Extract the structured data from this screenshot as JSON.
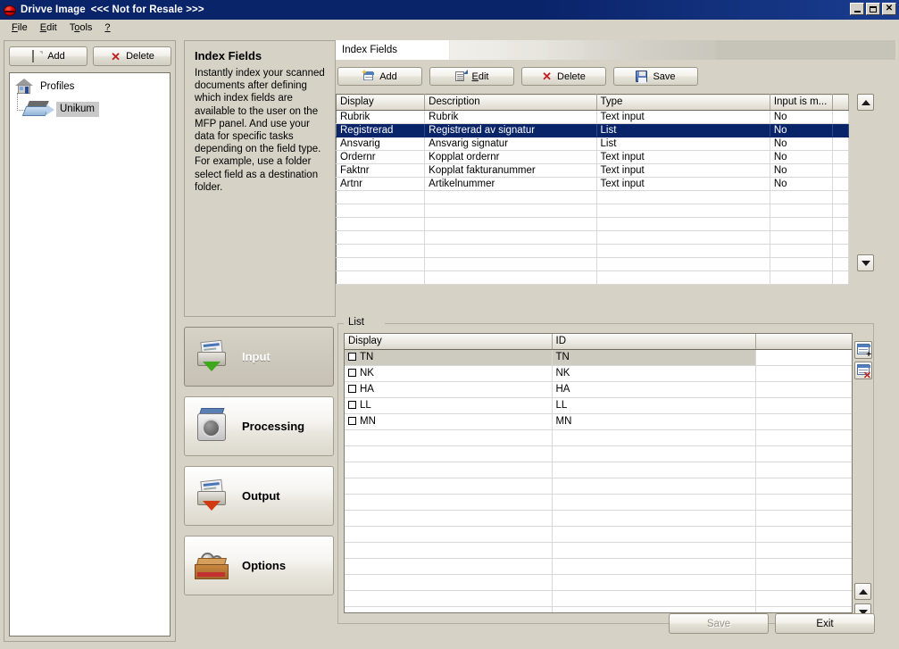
{
  "window": {
    "app_title": "Drivve Image",
    "title_suffix": "<<< Not for Resale >>>",
    "icon": "drivve-logo-icon",
    "controls": {
      "minimize": "minimize-button",
      "maximize": "maximize-button",
      "close": "close-button"
    }
  },
  "menubar": {
    "items": [
      "File",
      "Edit",
      "Tools",
      "?"
    ]
  },
  "left_panel": {
    "toolbar": {
      "add_label": "Add",
      "delete_label": "Delete"
    },
    "tree": {
      "root_label": "Profiles",
      "children": [
        {
          "label": "Unikum",
          "selected": true
        }
      ]
    }
  },
  "center_panel": {
    "description": {
      "title": "Index Fields",
      "body": "Instantly index your scanned documents after defining which index fields are available to the user on the MFP panel. And use your data for specific tasks depending on the field type. For example, use a folder select field as a destination folder."
    },
    "nav_buttons": [
      {
        "label": "Input",
        "icon": "input-tray-icon",
        "active": true
      },
      {
        "label": "Processing",
        "icon": "washing-machine-icon",
        "active": false
      },
      {
        "label": "Output",
        "icon": "output-tray-icon",
        "active": false
      },
      {
        "label": "Options",
        "icon": "options-box-icon",
        "active": false
      }
    ]
  },
  "right_panel": {
    "tab_active_label": "Index Fields",
    "toolbar": [
      {
        "label": "Add",
        "icon": "add-record-icon"
      },
      {
        "label": "Edit",
        "icon": "edit-record-icon"
      },
      {
        "label": "Delete",
        "icon": "delete-x-icon"
      },
      {
        "label": "Save",
        "icon": "floppy-save-icon"
      }
    ],
    "fields_grid": {
      "columns": [
        "Display",
        "Description",
        "Type",
        "Input is m...",
        ""
      ],
      "rows": [
        {
          "display": "Rubrik",
          "description": "Rubrik",
          "type": "Text input",
          "mandatory": "No",
          "selected": false
        },
        {
          "display": "Registrerad",
          "description": "Registrerad av signatur",
          "type": "List",
          "mandatory": "No",
          "selected": true
        },
        {
          "display": "Ansvarig",
          "description": "Ansvarig signatur",
          "type": "List",
          "mandatory": "No",
          "selected": false
        },
        {
          "display": "Ordernr",
          "description": "Kopplat ordernr",
          "type": "Text input",
          "mandatory": "No",
          "selected": false
        },
        {
          "display": "Faktnr",
          "description": "Kopplat fakturanummer",
          "type": "Text input",
          "mandatory": "No",
          "selected": false
        },
        {
          "display": "Artnr",
          "description": "Artikelnummer",
          "type": "Text input",
          "mandatory": "No",
          "selected": false
        }
      ],
      "empty_rows": 7,
      "move_up_icon": "move-up-arrow-icon",
      "move_down_icon": "move-down-arrow-icon"
    },
    "list_group": {
      "legend": "List",
      "columns": [
        "Display",
        "ID",
        ""
      ],
      "rows": [
        {
          "display": "TN",
          "id": "TN",
          "checked": false,
          "selected": true
        },
        {
          "display": "NK",
          "id": "NK",
          "checked": false,
          "selected": false
        },
        {
          "display": "HA",
          "id": "HA",
          "checked": false,
          "selected": false
        },
        {
          "display": "LL",
          "id": "LL",
          "checked": false,
          "selected": false
        },
        {
          "display": "MN",
          "id": "MN",
          "checked": false,
          "selected": false
        }
      ],
      "empty_rows": 12,
      "add_row_icon": "add-row-icon",
      "delete_row_icon": "delete-row-icon",
      "move_up_icon": "list-move-up-arrow-icon",
      "move_down_icon": "list-move-down-arrow-icon"
    }
  },
  "footer": {
    "save_label": "Save",
    "save_enabled": false,
    "exit_label": "Exit"
  }
}
